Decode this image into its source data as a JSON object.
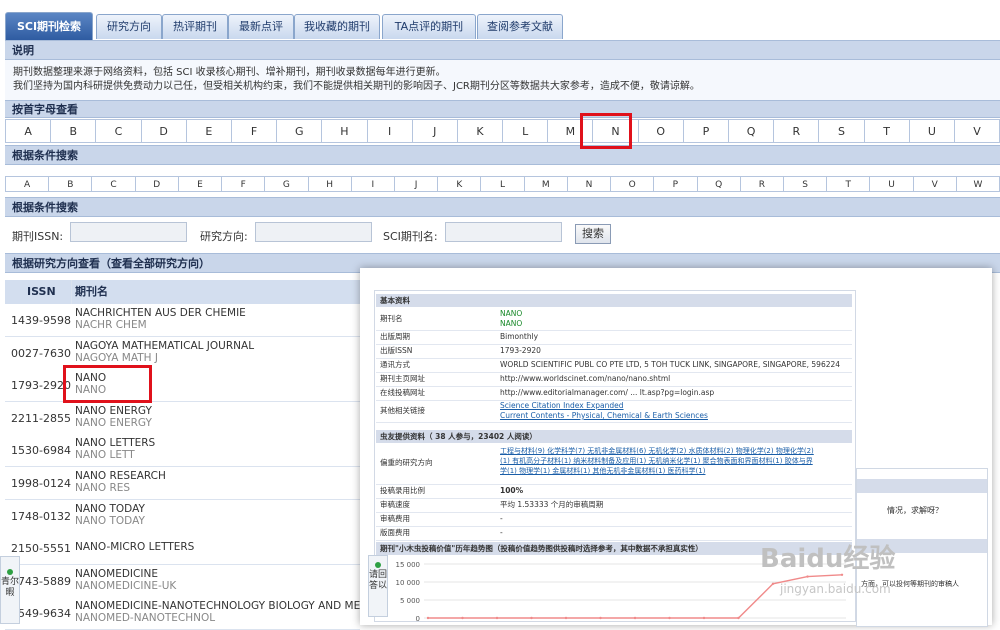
{
  "tabs": [
    "SCI期刊检索",
    "研究方向",
    "热评期刊",
    "最新点评",
    "我收藏的期刊",
    "TA点评的期刊",
    "查阅参考文献"
  ],
  "notice": {
    "title": "说明",
    "line1": "期刊数据整理来源于网络资料，包括 SCI 收录核心期刊、增补期刊，期刊收录数据每年进行更新。",
    "line2": "我们坚持为国内科研提供免费动力以己任，但受相关机构约束，我们不能提供相关期刊的影响因子、JCR期刊分区等数据共大家参考，造成不便，敬请谅解。"
  },
  "letter_section_title": "按首字母查看",
  "condition_section_title": "根据条件搜索",
  "letters_top": [
    "A",
    "B",
    "C",
    "D",
    "E",
    "F",
    "G",
    "H",
    "I",
    "J",
    "K",
    "L",
    "M",
    "N",
    "O",
    "P",
    "Q",
    "R",
    "S",
    "T",
    "U",
    "V"
  ],
  "letters_bottom": [
    "A",
    "B",
    "C",
    "D",
    "E",
    "F",
    "G",
    "H",
    "I",
    "J",
    "K",
    "L",
    "M",
    "N",
    "O",
    "P",
    "Q",
    "R",
    "S",
    "T",
    "U",
    "V",
    "W"
  ],
  "search": {
    "title": "根据条件搜索",
    "issn_label": "期刊ISSN:",
    "direction_label": "研究方向:",
    "name_label": "SCI期刊名:",
    "button": "搜索"
  },
  "research_title": "根据研究方向查看（查看全部研究方向）",
  "table": {
    "headers": [
      "ISSN",
      "期刊名"
    ],
    "rows": [
      {
        "issn": "1439-9598",
        "name": "NACHRICHTEN AUS DER CHEMIE",
        "abbr": "NACHR CHEM"
      },
      {
        "issn": "0027-7630",
        "name": "NAGOYA MATHEMATICAL JOURNAL",
        "abbr": "NAGOYA MATH J"
      },
      {
        "issn": "1793-2920",
        "name": "NANO",
        "abbr": "NANO"
      },
      {
        "issn": "2211-2855",
        "name": "NANO ENERGY",
        "abbr": "NANO ENERGY"
      },
      {
        "issn": "1530-6984",
        "name": "NANO LETTERS",
        "abbr": "NANO LETT"
      },
      {
        "issn": "1998-0124",
        "name": "NANO RESEARCH",
        "abbr": "NANO RES"
      },
      {
        "issn": "1748-0132",
        "name": "NANO TODAY",
        "abbr": "NANO TODAY"
      },
      {
        "issn": "2150-5551",
        "name": "NANO-MICRO LETTERS",
        "abbr": ""
      },
      {
        "issn": "1743-5889",
        "name": "NANOMEDICINE",
        "abbr": "NANOMEDICINE-UK"
      },
      {
        "issn": "1549-9634",
        "name": "NANOMEDICINE-NANOTECHNOLOGY BIOLOGY AND MEDI",
        "abbr": "NANOMED-NANOTECHNOL"
      }
    ]
  },
  "detail": {
    "section_basic": "基本资料",
    "fields": [
      {
        "k": "期刊名",
        "v": "NANO",
        "v2": "NANO"
      },
      {
        "k": "出版周期",
        "v": "Bimonthly"
      },
      {
        "k": "出版ISSN",
        "v": "1793-2920"
      },
      {
        "k": "通讯方式",
        "v": "WORLD SCIENTIFIC PUBL CO PTE LTD, 5 TOH TUCK LINK, SINGAPORE, SINGAPORE, 596224"
      },
      {
        "k": "期刊主页网址",
        "v": "http://www.worldscinet.com/nano/nano.shtml"
      },
      {
        "k": "在线投稿网址",
        "v": "http://www.editorialmanager.com/ ... lt.asp?pg=login.asp"
      },
      {
        "k": "其他相关链接",
        "v": "Science Citation Index Expanded",
        "v2": "Current Contents - Physical, Chemical & Earth Sciences"
      }
    ],
    "section_user": "虫友提供资料（ 38 人参与，23402 人阅读）",
    "direction_label": "偏重的研究方向",
    "direction_line1": "工程与材料(9)  化学科学(7)  无机非金属材料(6)  无机化学(2)  水质体材料(2)  物理化学(2)  物理化学(2)",
    "direction_line2": "(1)  有机高分子材料(1)  纳米材料制备及应用(1)  无机纳米化学(1)  聚合物表面和界面材料(1)  胶体与界",
    "direction_line3": "学(1)  物理学(1)  金属材料(1)  其他无机非金属材料(1)  医药科学(1)",
    "ratio_label": "投稿录用比例",
    "ratio_value": "100%",
    "speed_label": "审稿速度",
    "speed_value": "平均 1.53333 个月的审稿周期",
    "fee_label": "审稿费用",
    "fee_value": "-",
    "page_label": "版面费用",
    "page_value": "-",
    "chart_title": "期刊\"小木虫投稿价值\"历年趋势图（投稿价值趋势图供投稿时选择参考，其中数据不承担真实性）"
  },
  "side_button_1": "青尔暇",
  "side_button_2": "请回答以",
  "side_hint": "情况，求解呀？",
  "side_hint2": "方面，可以投何等期刊的审稿人",
  "watermark": "Baidu经验",
  "watermark_url": "jingyan.baidu.com",
  "chart_data": {
    "type": "line",
    "title": "",
    "xlabel": "",
    "ylabel": "",
    "y_ticks": [
      "15 000",
      "10 000",
      "5 000",
      "0"
    ],
    "ylim": [
      0,
      15000
    ],
    "series": [
      {
        "values": [
          0,
          0,
          0,
          0,
          0,
          0,
          0,
          0,
          0,
          0,
          9500,
          11500,
          12000
        ]
      }
    ]
  },
  "colors": {
    "accent": "#2d5aa0",
    "highlight": "#e0111b",
    "header_bar": "#c9d6ea",
    "line": "#f08a8a"
  }
}
